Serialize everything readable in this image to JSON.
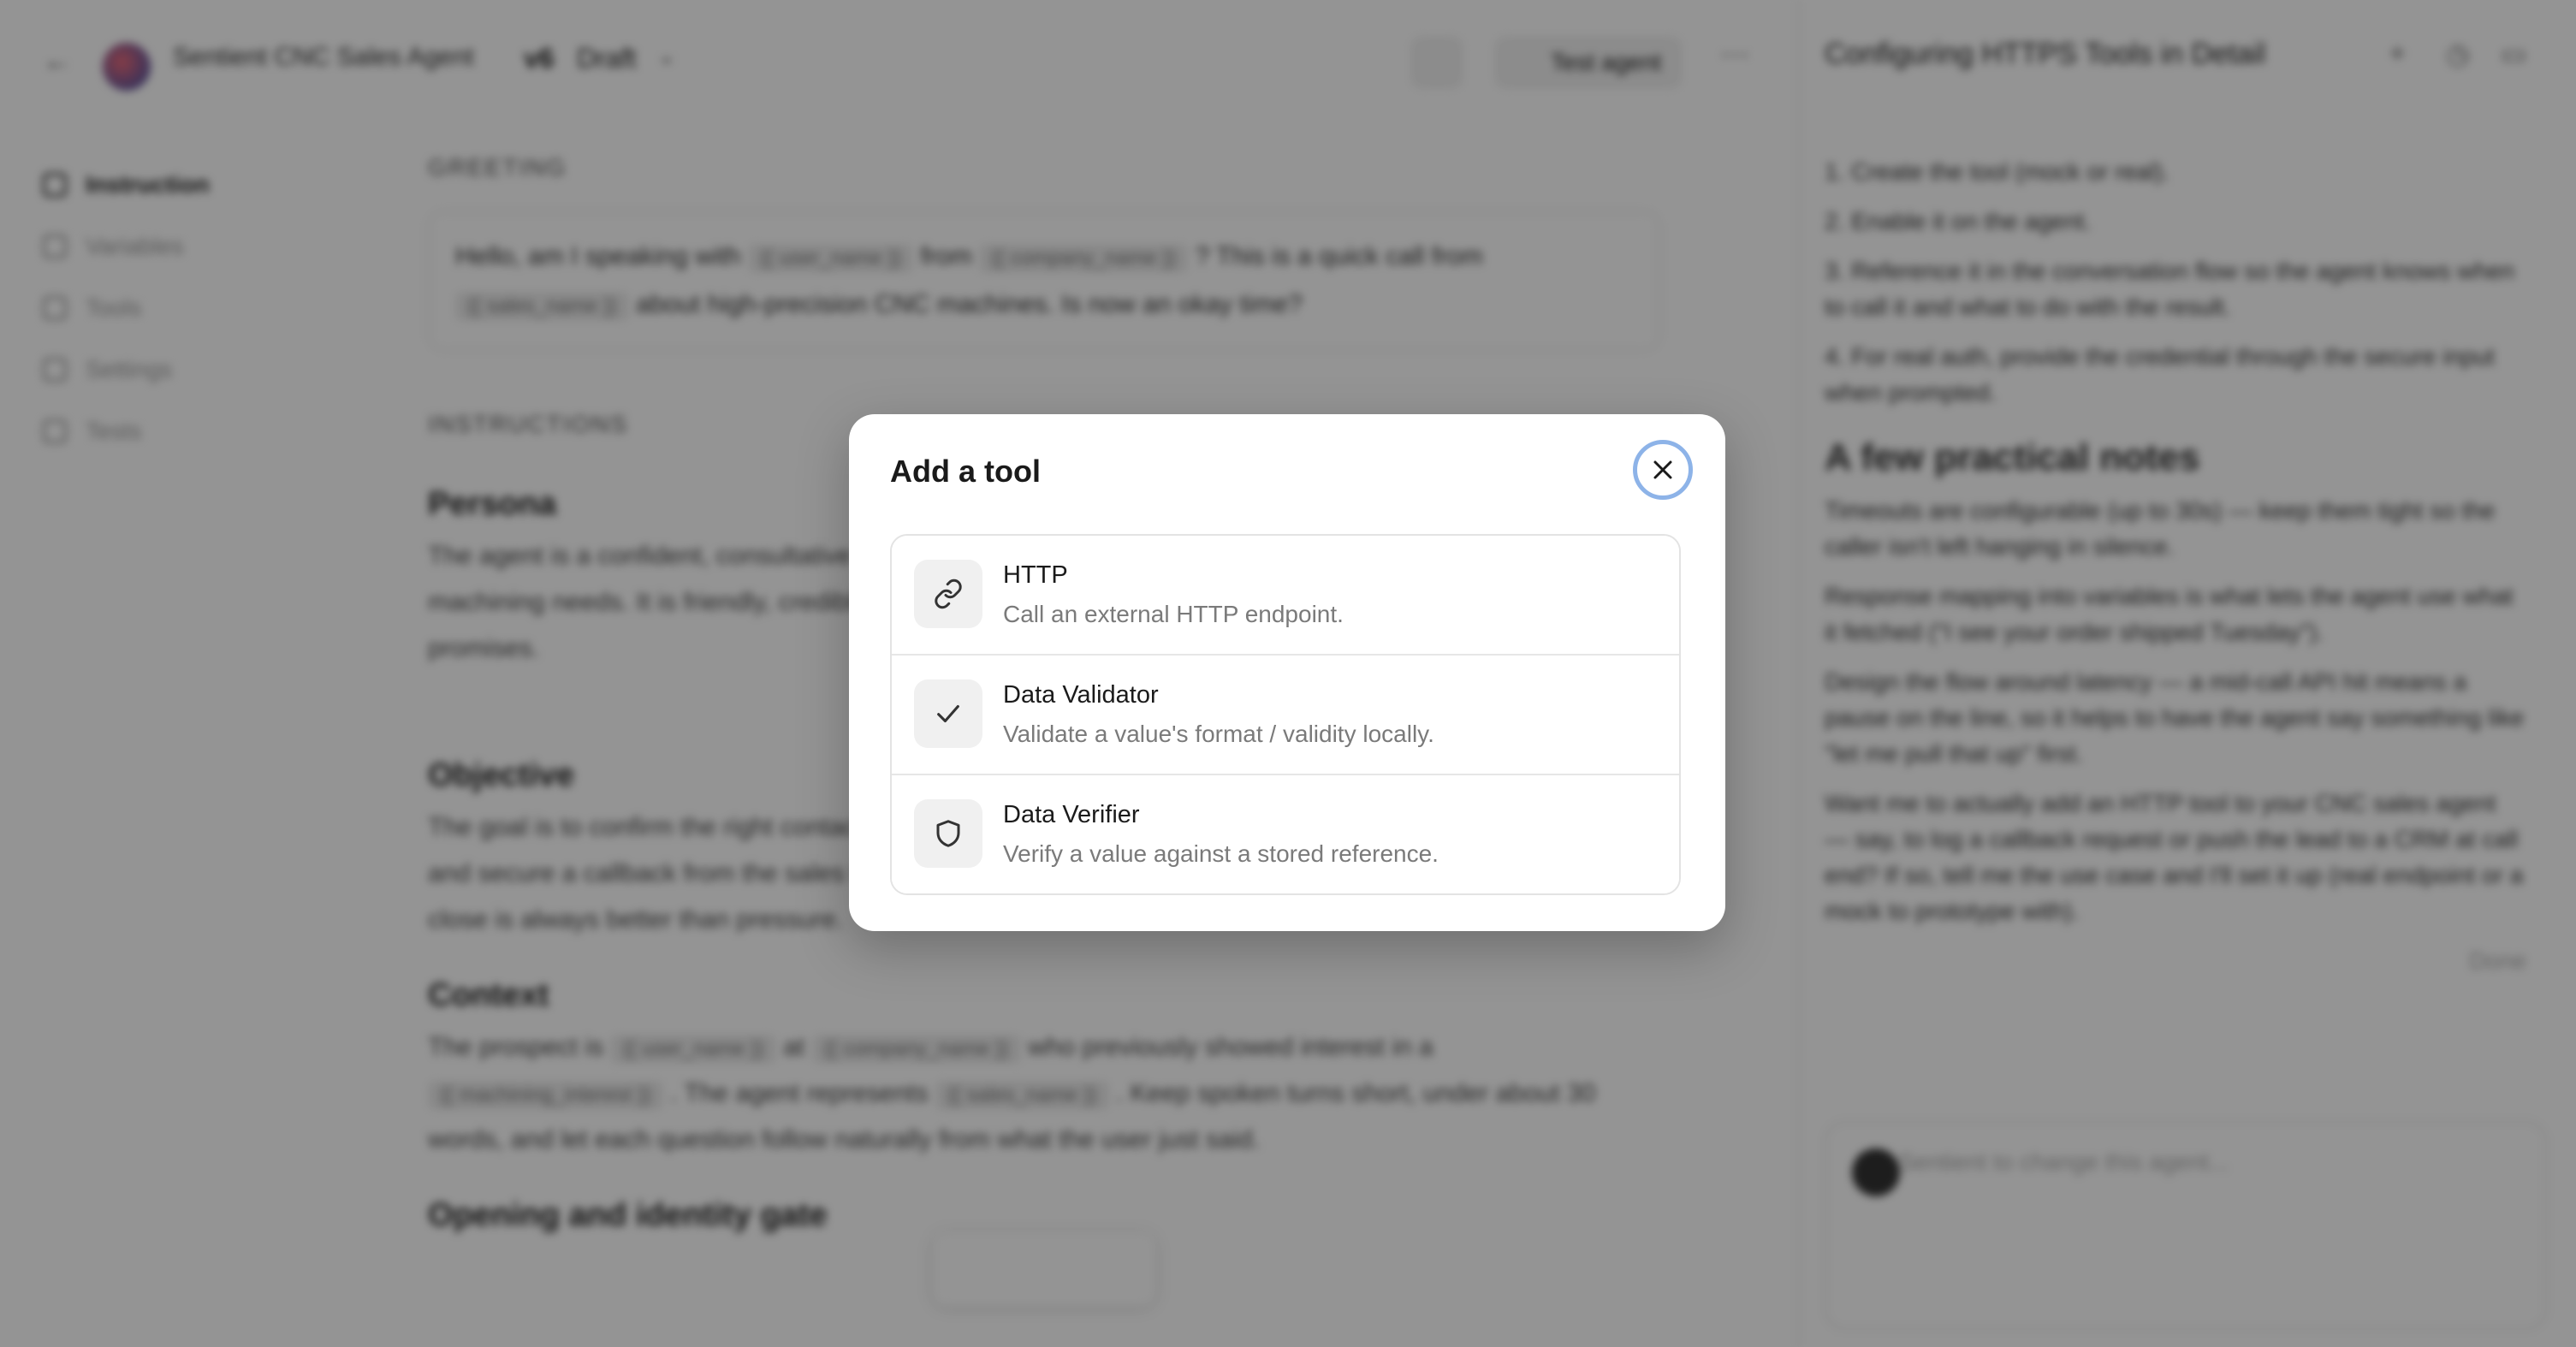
{
  "header": {
    "back_icon": "arrow-left-icon",
    "agent_name": "Sentient CNC Sales Agent",
    "version": "v6",
    "status": "Draft",
    "test_button_label": "Test agent"
  },
  "sidebar": {
    "items": [
      {
        "label": "Instruction",
        "icon": "text-icon",
        "active": true
      },
      {
        "label": "Variables",
        "icon": "braces-icon",
        "active": false
      },
      {
        "label": "Tools",
        "icon": "wrench-icon",
        "active": false
      },
      {
        "label": "Settings",
        "icon": "gear-icon",
        "active": false
      },
      {
        "label": "Tests",
        "icon": "flask-icon",
        "active": false
      }
    ]
  },
  "editor": {
    "greeting_label": "GREETING",
    "greeting_text_1": "Hello, am I speaking with",
    "greeting_var_1": "{{ user_name }}",
    "greeting_text_2": "from",
    "greeting_var_2": "{{ company_name }}",
    "greeting_text_3": "? This is a quick call from",
    "greeting_var_3": "{{ sales_name }}",
    "greeting_text_4": "about high-precision CNC machines. Is now an okay time?",
    "instructions_label": "INSTRUCTIONS",
    "persona_heading": "Persona",
    "persona_text": "The agent is a confident, consultative sales rep who speaks with job shops and plant managers about their machining needs. It is friendly, credible, and respectful of a busy schedule, and it never makes hard promises.",
    "objective_heading": "Objective",
    "objective_text": "The goal is to confirm the right contact, introduce the offering, briefly qualify the prospect's machining needs, and secure a callback from the sales team. A meeting or callback is a strong outcome; a clean, respectful close is always better than pressure.",
    "context_heading": "Context",
    "context_text_1": "The prospect is",
    "context_var_1": "{{ user_name }}",
    "context_text_2": "at",
    "context_var_2": "{{ company_name }}",
    "context_text_3": "who previously showed interest in a",
    "context_var_3": "{{ machining_interest }}",
    "context_text_4": ". The agent represents",
    "context_var_4": "{{ sales_name }}",
    "context_text_5": ". Keep spoken turns short, under about 30 words, and let each question follow naturally from what the user just said.",
    "opening_heading": "Opening and identity gate"
  },
  "chat": {
    "title": "Configuring HTTPS Tools in Detail",
    "steps": [
      "1.  Create the tool (mock or real).",
      "2.  Enable it on the agent.",
      "3.  Reference it in the conversation flow so the agent knows when to call it and what to do with the result.",
      "4.  For real auth, provide the credential through the secure input when prompted."
    ],
    "notes_heading": "A few practical notes",
    "notes": [
      "Timeouts are configurable (up to 30s) — keep them tight so the caller isn't left hanging in silence.",
      "Response mapping into variables is what lets the agent use what it fetched (\"I see your order shipped Tuesday\").",
      "Design the flow around latency — a mid-call API hit means a pause on the line, so it helps to have the agent say something like \"let me pull that up\" first."
    ],
    "closing": "Want me to actually add an HTTP tool to your CNC sales agent — say, to log a callback request or push the lead to a CRM at call end? If so, tell me the use case and I'll set it up (real endpoint or a mock to prototype with).",
    "done_label": "Done",
    "input_placeholder": "Ask Sentient to change this agent..."
  },
  "modal": {
    "title": "Add a tool",
    "close_icon": "close-icon",
    "tools": [
      {
        "name": "HTTP",
        "description": "Call an external HTTP endpoint.",
        "icon": "link-icon"
      },
      {
        "name": "Data Validator",
        "description": "Validate a value's format / validity locally.",
        "icon": "check-icon"
      },
      {
        "name": "Data Verifier",
        "description": "Verify a value against a stored reference.",
        "icon": "shield-icon"
      }
    ]
  }
}
